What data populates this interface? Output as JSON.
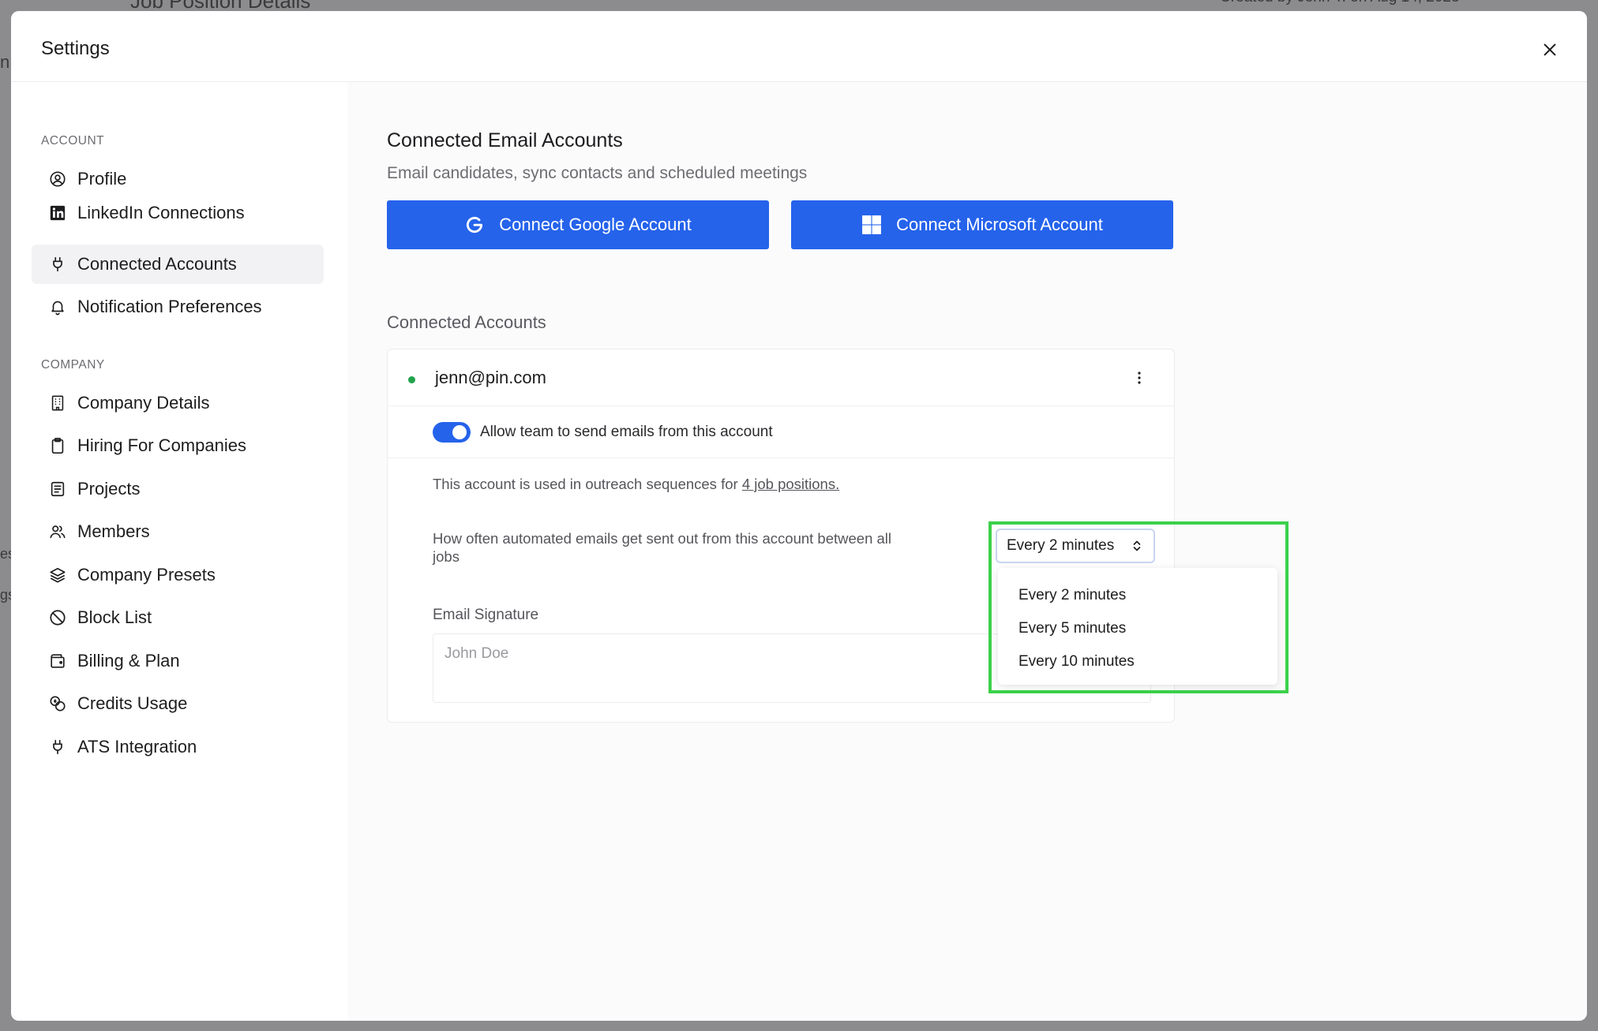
{
  "background": {
    "partial_texts": [
      {
        "text": "Job Position Details"
      },
      {
        "text": "Created by John Y. on Aug 14, 2023"
      },
      {
        "text": "n"
      },
      {
        "text": "es"
      },
      {
        "text": "gs"
      }
    ]
  },
  "modal": {
    "title": "Settings",
    "close_icon": "close-icon"
  },
  "sidebar": {
    "sections": [
      {
        "label": "ACCOUNT",
        "items": [
          {
            "label": "Profile",
            "icon": "user-circle-icon",
            "active": false
          },
          {
            "label": "LinkedIn Connections",
            "icon": "linkedin-icon",
            "active": false
          },
          {
            "label": "Connected Accounts",
            "icon": "plug-icon",
            "active": true
          },
          {
            "label": "Notification Preferences",
            "icon": "bell-icon",
            "active": false
          }
        ]
      },
      {
        "label": "COMPANY",
        "items": [
          {
            "label": "Company Details",
            "icon": "building-icon",
            "active": false
          },
          {
            "label": "Hiring For Companies",
            "icon": "clipboard-icon",
            "active": false
          },
          {
            "label": "Projects",
            "icon": "list-doc-icon",
            "active": false
          },
          {
            "label": "Members",
            "icon": "users-icon",
            "active": false
          },
          {
            "label": "Company Presets",
            "icon": "layers-icon",
            "active": false
          },
          {
            "label": "Block List",
            "icon": "ban-icon",
            "active": false
          },
          {
            "label": "Billing & Plan",
            "icon": "wallet-icon",
            "active": false
          },
          {
            "label": "Credits Usage",
            "icon": "coins-icon",
            "active": false
          },
          {
            "label": "ATS Integration",
            "icon": "plug-icon",
            "active": false
          }
        ]
      }
    ]
  },
  "main": {
    "heading": "Connected Email Accounts",
    "subheading": "Email candidates, sync contacts and scheduled meetings",
    "google_button": "Connect Google Account",
    "microsoft_button": "Connect Microsoft Account",
    "connected_label": "Connected Accounts",
    "account": {
      "email": "jenn@pin.com",
      "status_color": "#22a34a",
      "toggle_label": "Allow team to send emails from this account",
      "toggle_on": true,
      "usage_prefix": "This account is used in outreach sequences for ",
      "usage_link": "4 job positions.",
      "frequency_label": "How often automated emails get sent out from this account between all jobs",
      "frequency_selected": "Every 2 minutes",
      "frequency_options": [
        "Every 2 minutes",
        "Every 5 minutes",
        "Every 10 minutes"
      ],
      "signature_label": "Email Signature",
      "signature_placeholder": "John Doe"
    }
  },
  "colors": {
    "accent": "#2563eb",
    "highlight": "#3cd14b"
  }
}
